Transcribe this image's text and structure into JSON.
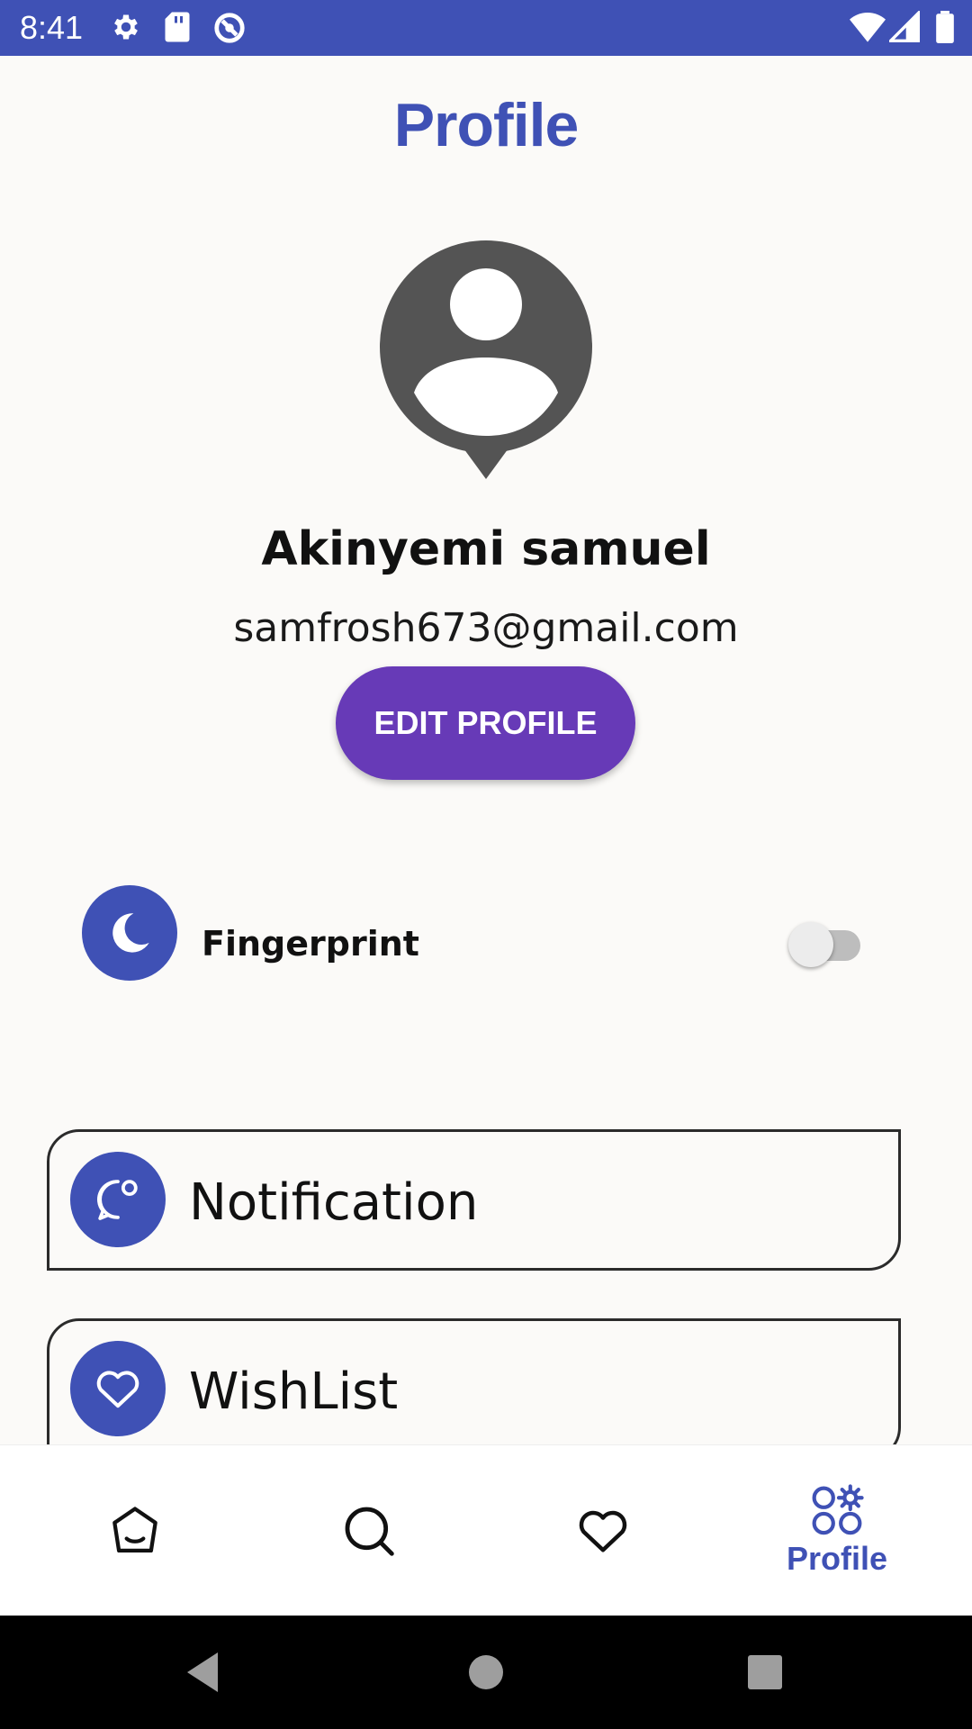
{
  "status_bar": {
    "time": "8:41",
    "background": "#3F51B5",
    "icons": [
      "gear-icon",
      "sd-card-icon",
      "sync-icon",
      "wifi-icon",
      "signal-icon",
      "battery-icon"
    ]
  },
  "header": {
    "title": "Profile"
  },
  "profile": {
    "avatar": "user-avatar-icon",
    "name": "Akinyemi samuel",
    "email": "samfrosh673@gmail.com",
    "edit_button": "EDIT PROFILE"
  },
  "settings": {
    "fingerprint_label": "Fingerprint",
    "fingerprint_enabled": false,
    "fingerprint_icon": "moon-icon"
  },
  "menu": [
    {
      "label": "Notification",
      "icon": "chat-bubble-icon"
    },
    {
      "label": "WishList",
      "icon": "heart-icon"
    }
  ],
  "bottom_nav": {
    "items": [
      {
        "id": "home",
        "icon": "home-icon",
        "label": ""
      },
      {
        "id": "search",
        "icon": "search-icon",
        "label": ""
      },
      {
        "id": "wishlist",
        "icon": "heart-icon",
        "label": ""
      },
      {
        "id": "profile",
        "icon": "category-icon",
        "label": "Profile",
        "active": true
      }
    ]
  },
  "colors": {
    "primary": "#3F51B5",
    "button": "#673AB7",
    "background": "#FBFAF8"
  }
}
